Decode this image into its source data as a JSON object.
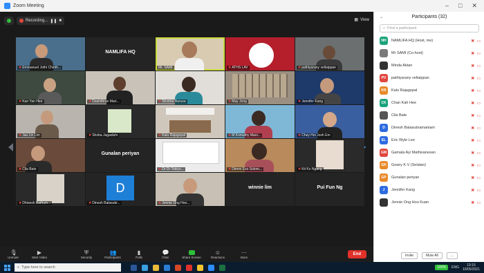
{
  "window": {
    "title": "Zoom Meeting",
    "controls": [
      "–",
      "□",
      "✕"
    ]
  },
  "topbar": {
    "recording_label": "Recording...",
    "view_label": "View"
  },
  "tiles": [
    {
      "name": "Emmanuel Jothi Chinth...",
      "center": ""
    },
    {
      "name": "",
      "center": "NAMLIFA HQ"
    },
    {
      "name": "Mr. SAMI",
      "center": ""
    },
    {
      "name": "ATHS LAV",
      "center": ""
    },
    {
      "name": "pathiyarany vellaippan",
      "center": ""
    },
    {
      "name": "Kan Yan Hee",
      "center": ""
    },
    {
      "name": "Dasinthran Mari...",
      "center": ""
    },
    {
      "name": "Shobha Barusa",
      "center": ""
    },
    {
      "name": "May Jong",
      "center": ""
    },
    {
      "name": "Jennifer Kang",
      "center": ""
    },
    {
      "name": "Jau Lin Lim",
      "center": ""
    },
    {
      "name": "Shoba Jagadishi",
      "center": ""
    },
    {
      "name": "Kalu Rajagopal",
      "center": ""
    },
    {
      "name": "M Komathy Mani...",
      "center": ""
    },
    {
      "name": "Chey Hoi Josh Em",
      "center": ""
    },
    {
      "name": "Cila Bate",
      "center": ""
    },
    {
      "name": "",
      "center": "Gunalan periyan"
    },
    {
      "name": "Dr Dr Tokiyo...",
      "center": ""
    },
    {
      "name": "Dimmi Eso Solom...",
      "center": ""
    },
    {
      "name": "Kit Ko Ngang",
      "center": ""
    },
    {
      "name": "Dhinesh Bathum...",
      "center": ""
    },
    {
      "name": "Dinesh Balasubr...",
      "center": ""
    },
    {
      "name": "Jennie Ong Hoo...",
      "center": ""
    },
    {
      "name": "",
      "center": "winnie lim"
    },
    {
      "name": "",
      "center": "Pui Fun Ng"
    }
  ],
  "toolbar": {
    "items": [
      "Unmute",
      "Start Video",
      "Security",
      "Participants",
      "Polls",
      "Chat",
      "Share Screen",
      "Reactions",
      "More"
    ],
    "participants_count": "32",
    "end_label": "End"
  },
  "panel": {
    "title": "Participants (32)",
    "search_placeholder": "Find a participant",
    "participants": [
      {
        "initials": "NH",
        "name": "NAMLIFA HQ (Host, me)",
        "color": "#1aa37a"
      },
      {
        "initials": "",
        "name": "Mr SAMI (Co-host)",
        "color": "#7a7a7a"
      },
      {
        "initials": "",
        "name": "Minda Aktan",
        "color": "#333333"
      },
      {
        "initials": "PV",
        "name": "pathiyarany vellaippan",
        "color": "#e0473f"
      },
      {
        "initials": "KR",
        "name": "Kalu Rajagopal",
        "color": "#e88a2a"
      },
      {
        "initials": "CK",
        "name": "Chan Kah Hee",
        "color": "#1aa37a"
      },
      {
        "initials": "",
        "name": "Cila Bate",
        "color": "#555555"
      },
      {
        "initials": "D",
        "name": "Dinesh Balasubramaniam",
        "color": "#2d6be0"
      },
      {
        "initials": "EL",
        "name": "Eric Wyle Lee",
        "color": "#2d6be0"
      },
      {
        "initials": "GM",
        "name": "Gamala Ayi Mathivanesan",
        "color": "#e0473f"
      },
      {
        "initials": "GK",
        "name": "Gowry K V (Selatan)",
        "color": "#e88a2a"
      },
      {
        "initials": "GP",
        "name": "Gunalan periyan",
        "color": "#e88a2a"
      },
      {
        "initials": "J",
        "name": "Jennifer Kang",
        "color": "#2d6be0"
      },
      {
        "initials": "",
        "name": "Jennie Ong Hoo Kuan",
        "color": "#333333"
      }
    ],
    "footer": [
      "Invite",
      "Mute All",
      "..."
    ]
  },
  "taskbar": {
    "search_placeholder": "Type here to search",
    "battery": "100%",
    "lang": "ENG",
    "time": "19:16",
    "date": "10/05/2021"
  }
}
